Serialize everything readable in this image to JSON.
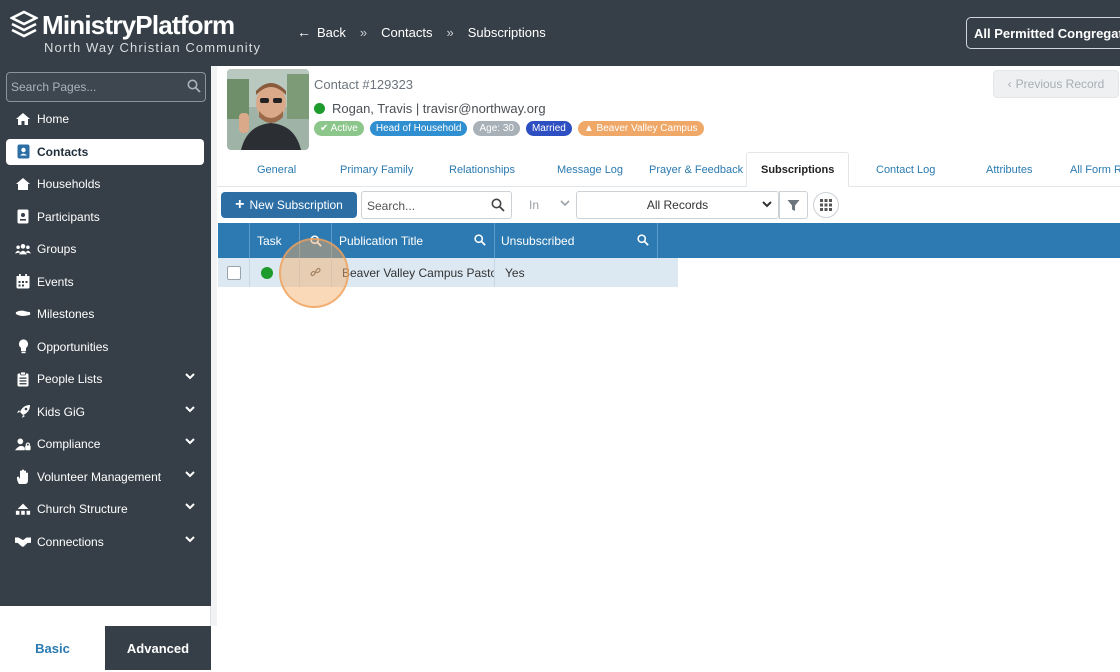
{
  "app": {
    "title": "MinistryPlatform",
    "subtitle": "North Way Christian Community"
  },
  "breadcrumb": {
    "back": "Back",
    "items": [
      "Contacts",
      "Subscriptions"
    ]
  },
  "congregation_filter": "All Permitted Congregations",
  "sidebar": {
    "search_placeholder": "Search Pages...",
    "items": [
      {
        "label": "Home",
        "icon": "home-icon"
      },
      {
        "label": "Contacts",
        "icon": "contact-card-icon",
        "active": true
      },
      {
        "label": "Households",
        "icon": "house-icon"
      },
      {
        "label": "Participants",
        "icon": "id-badge-icon"
      },
      {
        "label": "Groups",
        "icon": "people-group-icon"
      },
      {
        "label": "Events",
        "icon": "calendar-icon"
      },
      {
        "label": "Milestones",
        "icon": "shoe-prints-icon"
      },
      {
        "label": "Opportunities",
        "icon": "lightbulb-icon"
      },
      {
        "label": "People Lists",
        "icon": "clipboard-list-icon",
        "expandable": true
      },
      {
        "label": "Kids GiG",
        "icon": "rocket-icon",
        "expandable": true
      },
      {
        "label": "Compliance",
        "icon": "user-lock-icon",
        "expandable": true
      },
      {
        "label": "Volunteer Management",
        "icon": "hand-icon",
        "expandable": true
      },
      {
        "label": "Church Structure",
        "icon": "sitemap-icon",
        "expandable": true
      },
      {
        "label": "Connections",
        "icon": "handshake-icon",
        "expandable": true
      }
    ],
    "mode_tabs": {
      "basic": "Basic",
      "advanced": "Advanced"
    }
  },
  "contact": {
    "number": "Contact #129323",
    "name_line": "Rogan, Travis | travisr@northway.org",
    "badges": [
      {
        "label": "Active",
        "color": "#8cc68a"
      },
      {
        "label": "Head of Household",
        "color": "#2f8fd0"
      },
      {
        "label": "Age: 30",
        "color": "#a9b1b8"
      },
      {
        "label": "Married",
        "color": "#2e4fc2"
      },
      {
        "label": "Beaver Valley Campus",
        "color": "#f0a868"
      }
    ],
    "previous_record": "Previous Record"
  },
  "tabs": [
    {
      "label": "General"
    },
    {
      "label": "Primary Family"
    },
    {
      "label": "Relationships"
    },
    {
      "label": "Message Log"
    },
    {
      "label": "Prayer & Feedback"
    },
    {
      "label": "Subscriptions",
      "active": true
    },
    {
      "label": "Contact Log"
    },
    {
      "label": "Attributes"
    },
    {
      "label": "All Form Responses"
    }
  ],
  "toolbar": {
    "new_button": "New Subscription",
    "search_placeholder": "Search...",
    "in_label": "In",
    "records_select": "All Records"
  },
  "grid": {
    "columns": [
      "Task",
      "Publication Title",
      "Unsubscribed"
    ],
    "rows": [
      {
        "publication_title": "Beaver Valley Campus Pastor",
        "unsubscribed": "Yes"
      }
    ]
  },
  "colors": {
    "header_bg": "#363f47",
    "accent": "#2d7ab2",
    "status_green": "#1e9b2d"
  }
}
